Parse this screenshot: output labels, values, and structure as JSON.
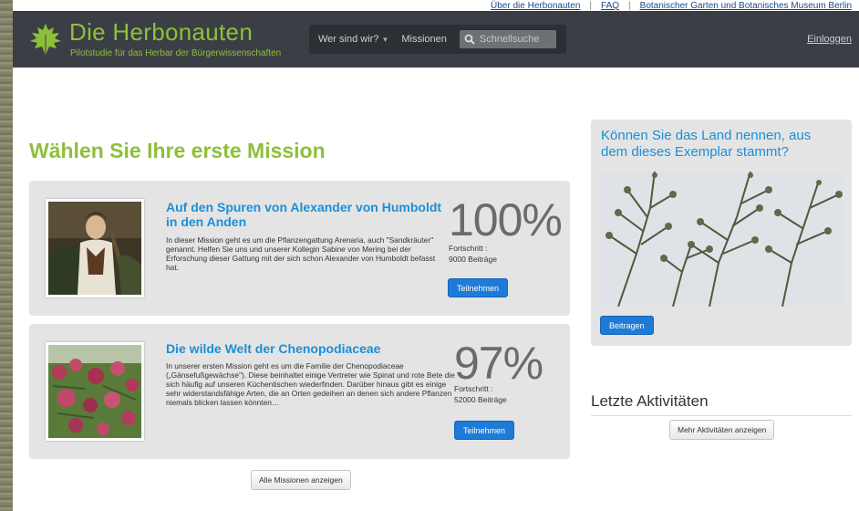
{
  "top_links": [
    "Über die Herbonauten",
    "FAQ",
    "Botanischer Garten und Botanisches Museum Berlin"
  ],
  "header": {
    "title": "Die Herbonauten",
    "subtitle": "Pilotstudie für das Herbar der Bürgerwissenschaften",
    "nav": {
      "who": "Wer sind wir?",
      "missions": "Missionen",
      "search_placeholder": "Schnellsuche"
    },
    "login": "Einloggen"
  },
  "main": {
    "heading": "Wählen Sie Ihre erste Mission",
    "missions": [
      {
        "title": "Auf den Spuren von Alexander von Humboldt in den Anden",
        "description": "In dieser Mission geht es um die Pflanzengattung Arenaria, auch \"Sandkräuter\" genannt. Helfen Sie uns und unserer Kollegin Sabine von Mering bei der Erforschung dieser Gattung mit der sich schon Alexander von Humboldt befasst hat.",
        "percent": "100%",
        "progress_label": "Fortschritt :",
        "contributions": "9000 Beiträge",
        "button": "Teilnehmen"
      },
      {
        "title": "Die wilde Welt der Chenopodiaceae",
        "description": "In unserer ersten Mission geht es um die Familie der Chenopodiaceae („Gänsefußgewächse\"). Diese beinhaltet einige Vertreter wie Spinat und rote Bete die sich häufig auf unseren Küchentischen wiederfinden. Darüber hinaus gibt es einige sehr widerstandsfähige Arten, die an Orten gedeihen an denen sich andere Pflanzen niemals blicken lassen könnten…",
        "percent": "97%",
        "progress_label": "Fortschritt :",
        "contributions": "52000 Beiträge",
        "button": "Teilnehmen"
      }
    ],
    "all_missions_button": "Alle Missionen anzeigen"
  },
  "sidebar": {
    "quiz_title": "Können Sie das Land nennen, aus dem dieses Exemplar stammt?",
    "contribute_button": "Beitragen",
    "activities_title": "Letzte Aktivitäten",
    "more_activities_button": "Mehr Aktivitäten anzeigen"
  },
  "colors": {
    "brand_green": "#8fbf3a",
    "link_blue": "#1b8fd8",
    "header_bg": "#3b3f45",
    "button_blue": "#1f7bd8",
    "card_bg": "#e4e4e4"
  },
  "icons": [
    "leaf-logo-icon",
    "search-icon",
    "chevron-down-icon"
  ]
}
